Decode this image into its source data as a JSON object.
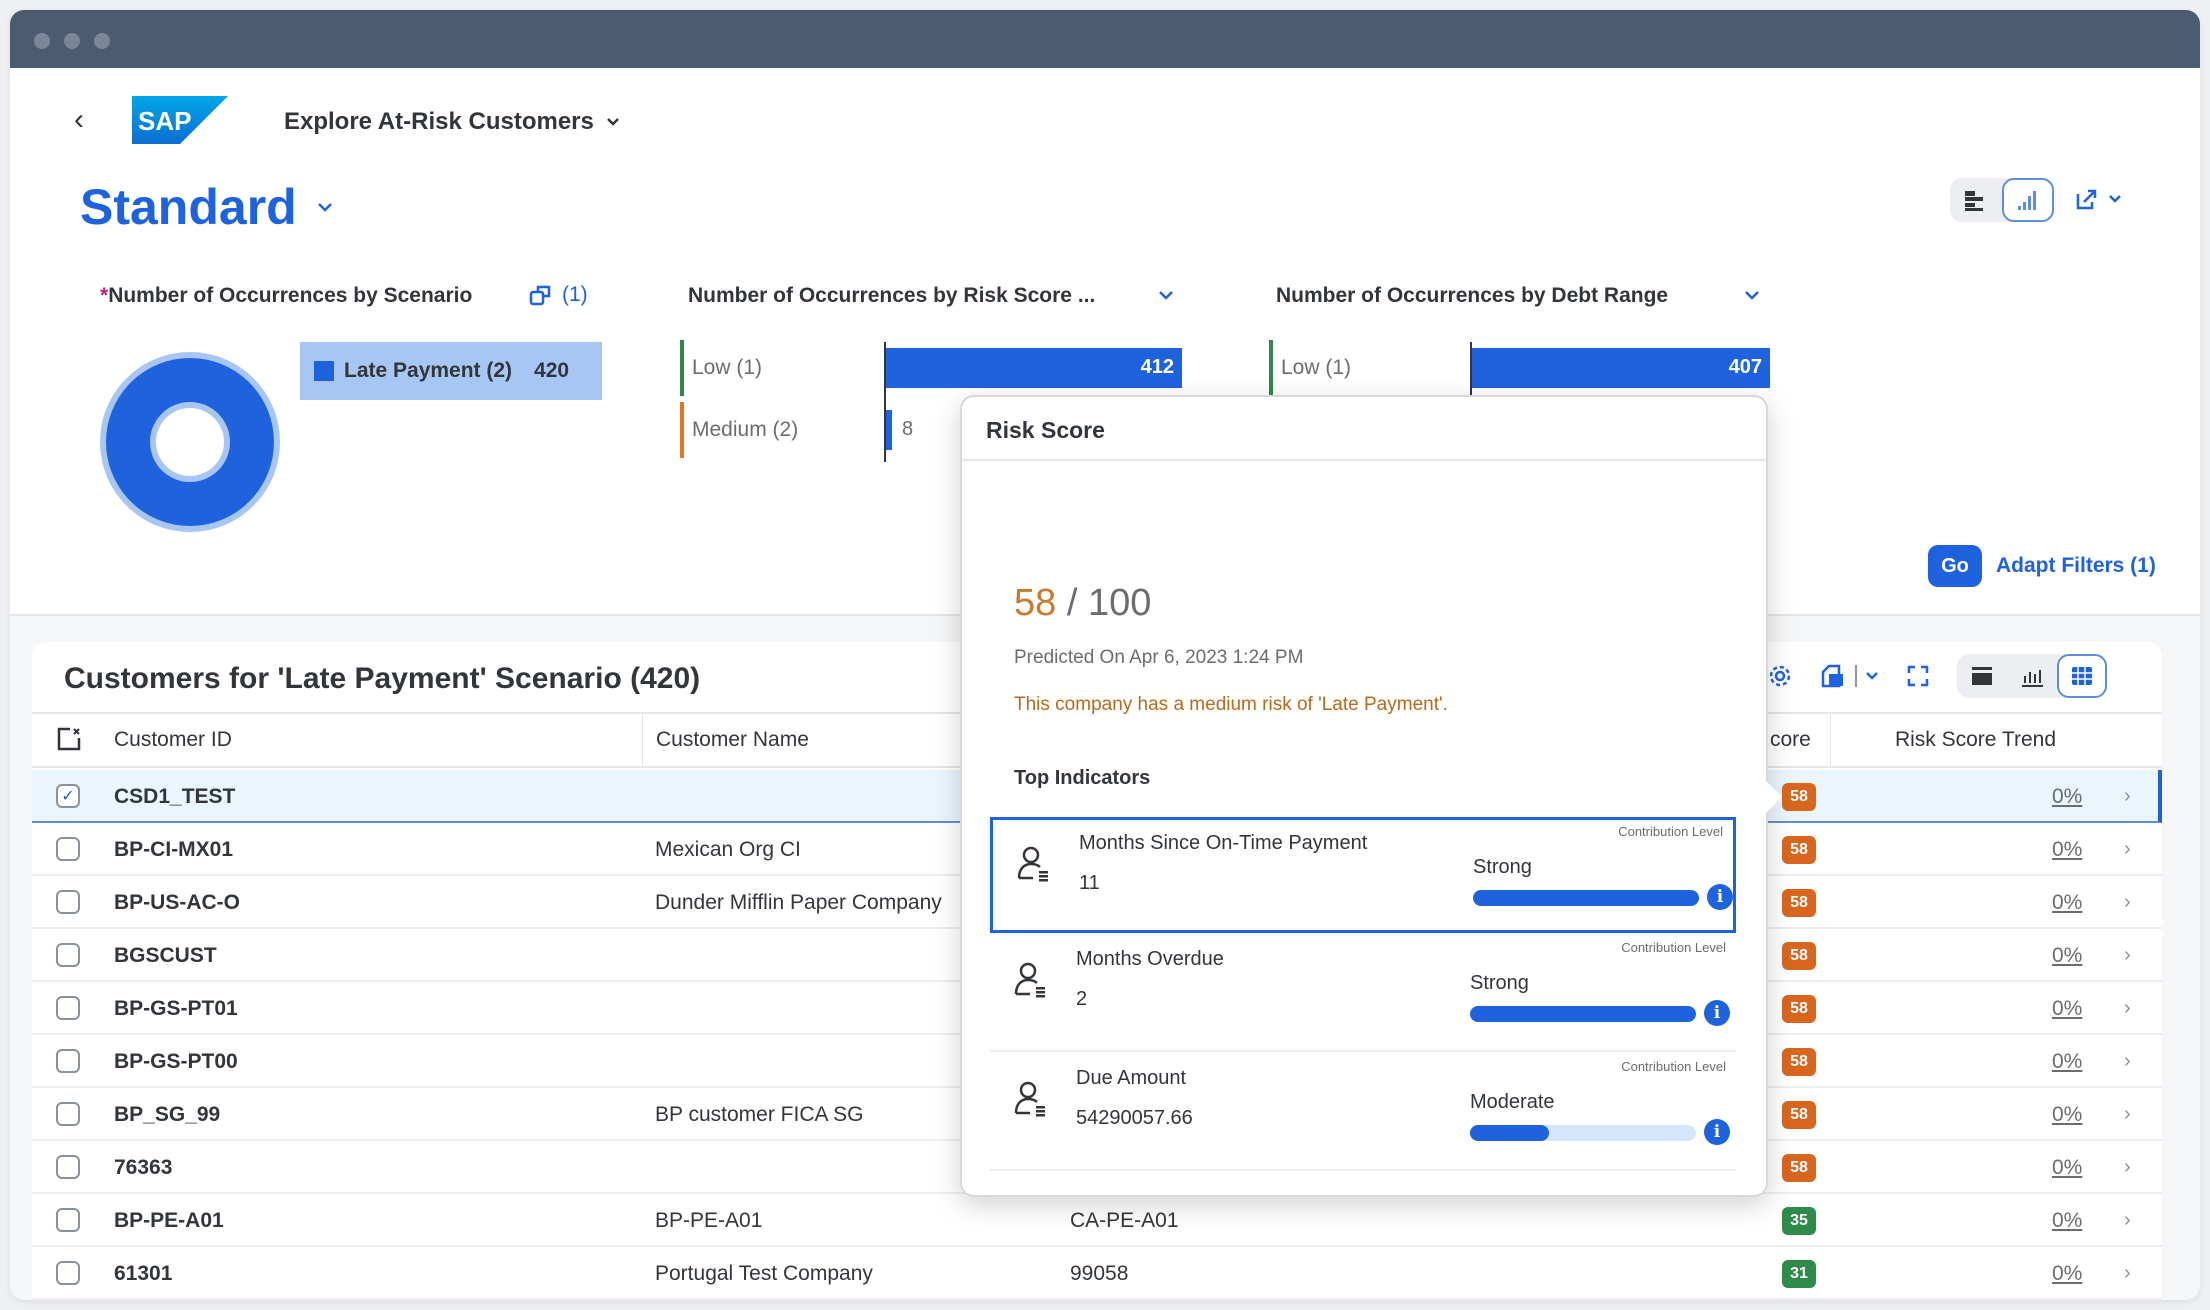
{
  "app": {
    "title": "Explore At-Risk Customers",
    "logo_text": "SAP",
    "variant": "Standard"
  },
  "filters": {
    "go_label": "Go",
    "adapt_label": "Adapt Filters (1)"
  },
  "cards": {
    "scenario": {
      "required_mark": "*",
      "title": "Number of Occurrences by Scenario",
      "selection_count": "(1)",
      "legend_label": "Late Payment (2)",
      "legend_value": "420"
    },
    "risk_score": {
      "title": "Number of Occurrences by Risk Score ..."
    },
    "debt_range": {
      "title": "Number of Occurrences by Debt Range"
    }
  },
  "chart_data": [
    {
      "type": "pie",
      "title": "Number of Occurrences by Scenario",
      "categories": [
        "Late Payment (2)"
      ],
      "values": [
        420
      ],
      "colors": [
        "#1f62dd"
      ]
    },
    {
      "type": "bar",
      "title": "Number of Occurrences by Risk Score ...",
      "categories": [
        "Low (1)",
        "Medium (2)"
      ],
      "values": [
        412,
        8
      ],
      "category_colors": [
        "#2e8b4a",
        "#e07a1f"
      ],
      "orientation": "horizontal",
      "xlim": [
        0,
        412
      ]
    },
    {
      "type": "bar",
      "title": "Number of Occurrences by Debt Range",
      "categories": [
        "Low (1)"
      ],
      "values": [
        407
      ],
      "category_colors": [
        "#2e8b4a"
      ],
      "orientation": "horizontal",
      "xlim": [
        0,
        407
      ]
    }
  ],
  "table": {
    "title": "Customers for 'Late Payment' Scenario (420)",
    "columns": {
      "id": "Customer ID",
      "name": "Customer Name",
      "score_partial": "core",
      "trend": "Risk Score Trend"
    },
    "rows": [
      {
        "id": "CSD1_TEST",
        "name": "",
        "third": "",
        "score": "58",
        "level": "medium",
        "trend": "0%",
        "selected": true
      },
      {
        "id": "BP-CI-MX01",
        "name": "Mexican Org CI",
        "third": "",
        "score": "58",
        "level": "medium",
        "trend": "0%",
        "selected": false
      },
      {
        "id": "BP-US-AC-O",
        "name": "Dunder Mifflin Paper Company",
        "third": "",
        "score": "58",
        "level": "medium",
        "trend": "0%",
        "selected": false
      },
      {
        "id": "BGSCUST",
        "name": "",
        "third": "",
        "score": "58",
        "level": "medium",
        "trend": "0%",
        "selected": false
      },
      {
        "id": "BP-GS-PT01",
        "name": "",
        "third": "",
        "score": "58",
        "level": "medium",
        "trend": "0%",
        "selected": false
      },
      {
        "id": "BP-GS-PT00",
        "name": "",
        "third": "",
        "score": "58",
        "level": "medium",
        "trend": "0%",
        "selected": false
      },
      {
        "id": "BP_SG_99",
        "name": "BP customer FICA SG",
        "third": "",
        "score": "58",
        "level": "medium",
        "trend": "0%",
        "selected": false
      },
      {
        "id": "76363",
        "name": "",
        "third": "",
        "score": "58",
        "level": "medium",
        "trend": "0%",
        "selected": false
      },
      {
        "id": "BP-PE-A01",
        "name": "BP-PE-A01",
        "third": "CA-PE-A01",
        "score": "35",
        "level": "low",
        "trend": "0%",
        "selected": false
      },
      {
        "id": "61301",
        "name": "Portugal Test Company",
        "third": "99058",
        "score": "31",
        "level": "low",
        "trend": "0%",
        "selected": false
      }
    ],
    "level_colors": {
      "medium": "#d9661f",
      "low": "#2e8b4a"
    }
  },
  "popover": {
    "title": "Risk Score",
    "score": "58",
    "score_max": "/ 100",
    "predicted": "Predicted On Apr 6, 2023 1:24 PM",
    "message": "This company has a medium risk of 'Late Payment'.",
    "section_title": "Top Indicators",
    "contribution_label": "Contribution Level",
    "indicators": [
      {
        "name": "Months Since On-Time Payment",
        "value": "11",
        "level": "Strong",
        "fill": 1.0,
        "focused": true
      },
      {
        "name": "Months Overdue",
        "value": "2",
        "level": "Strong",
        "fill": 1.0,
        "focused": false
      },
      {
        "name": "Due Amount",
        "value": "54290057.66",
        "level": "Moderate",
        "fill": 0.35,
        "focused": false
      }
    ]
  }
}
